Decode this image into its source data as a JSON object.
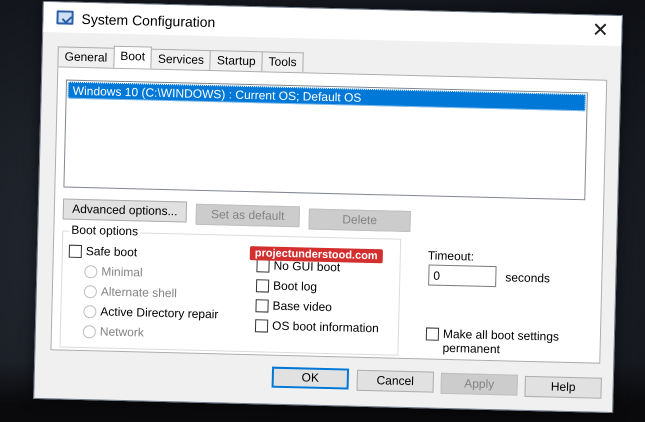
{
  "window": {
    "title": "System Configuration"
  },
  "tabs": [
    {
      "label": "General",
      "active": false
    },
    {
      "label": "Boot",
      "active": true
    },
    {
      "label": "Services",
      "active": false
    },
    {
      "label": "Startup",
      "active": false
    },
    {
      "label": "Tools",
      "active": false
    }
  ],
  "os_list": {
    "items": [
      "Windows 10 (C:\\WINDOWS) : Current OS; Default OS"
    ]
  },
  "actions": {
    "advanced_label": "Advanced options...",
    "set_default_label": "Set as default",
    "delete_label": "Delete"
  },
  "boot_options": {
    "label": "Boot options",
    "safe_boot": "Safe boot",
    "radios": [
      "Minimal",
      "Alternate shell",
      "Active Directory repair",
      "Network"
    ],
    "right_checks": [
      "No GUI boot",
      "Boot log",
      "Base video",
      "OS boot information"
    ]
  },
  "watermark": "projectunderstood.com",
  "timeout": {
    "label": "Timeout:",
    "value": "0",
    "unit": "seconds"
  },
  "permanent_label": "Make all boot settings permanent",
  "footer": {
    "ok": "OK",
    "cancel": "Cancel",
    "apply": "Apply",
    "help": "Help"
  },
  "colors": {
    "selection": "#0078d7",
    "watermark": "#d32f2f"
  }
}
